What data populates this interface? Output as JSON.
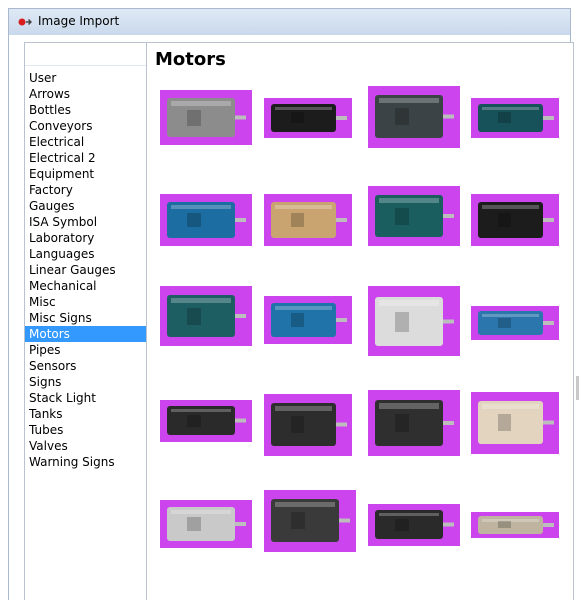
{
  "window": {
    "title": "Image Import",
    "icon": "app-logo-icon"
  },
  "sidebar": {
    "items": [
      {
        "label": "User"
      },
      {
        "label": "Arrows"
      },
      {
        "label": "Bottles"
      },
      {
        "label": "Conveyors"
      },
      {
        "label": "Electrical"
      },
      {
        "label": "Electrical 2"
      },
      {
        "label": "Equipment"
      },
      {
        "label": "Factory"
      },
      {
        "label": "Gauges"
      },
      {
        "label": "ISA Symbol"
      },
      {
        "label": "Laboratory"
      },
      {
        "label": "Languages"
      },
      {
        "label": "Linear Gauges"
      },
      {
        "label": "Mechanical"
      },
      {
        "label": "Misc"
      },
      {
        "label": "Misc Signs"
      },
      {
        "label": "Motors"
      },
      {
        "label": "Pipes"
      },
      {
        "label": "Sensors"
      },
      {
        "label": "Signs"
      },
      {
        "label": "Stack Light"
      },
      {
        "label": "Tanks"
      },
      {
        "label": "Tubes"
      },
      {
        "label": "Valves"
      },
      {
        "label": "Warning Signs"
      }
    ],
    "selected": "Motors"
  },
  "main": {
    "title": "Motors",
    "thumbnail_background": "#cc44ee",
    "thumbnails": [
      {
        "name": "motor-gray-large-icon"
      },
      {
        "name": "motor-black-small-icon"
      },
      {
        "name": "motor-dark-gray-icon"
      },
      {
        "name": "motor-teal-flat-icon"
      },
      {
        "name": "motor-blue-icon"
      },
      {
        "name": "motor-tan-icon"
      },
      {
        "name": "motor-dark-teal-icon"
      },
      {
        "name": "motor-black-white-icon"
      },
      {
        "name": "motor-teal-large-icon"
      },
      {
        "name": "motor-blue-ribbed-icon"
      },
      {
        "name": "motor-white-icon"
      },
      {
        "name": "motor-blue-gear-icon"
      },
      {
        "name": "servo-motor-black-icon"
      },
      {
        "name": "servo-motor-black-2-icon"
      },
      {
        "name": "servo-motor-black-3-icon"
      },
      {
        "name": "servo-motor-beige-icon"
      },
      {
        "name": "motor-silver-icon"
      },
      {
        "name": "stepper-motor-icon"
      },
      {
        "name": "gear-motor-black-icon"
      },
      {
        "name": "linear-actuator-icon"
      }
    ]
  }
}
